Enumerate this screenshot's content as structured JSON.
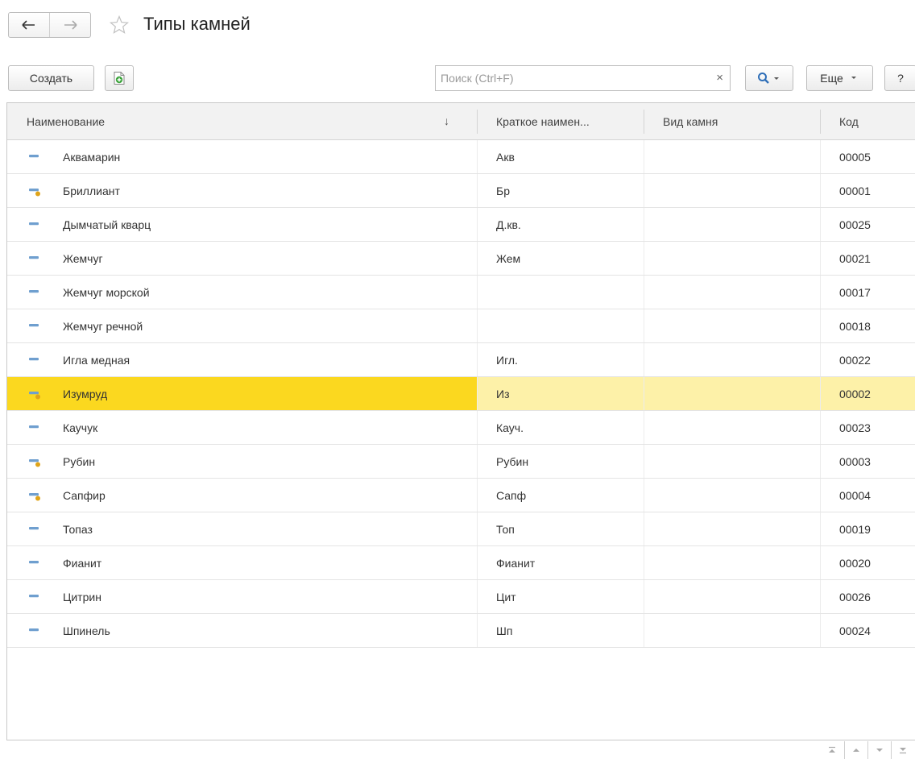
{
  "window": {
    "title": "Типы камней"
  },
  "toolbar": {
    "create_label": "Создать",
    "search_placeholder": "Поиск (Ctrl+F)",
    "clear_glyph": "×",
    "more_label": "Еще",
    "help_label": "?"
  },
  "table": {
    "columns": [
      "Наименование",
      "Краткое наимен...",
      "Вид камня",
      "Код"
    ],
    "sorted_column": "Наименование",
    "sort_direction": "↓",
    "rows": [
      {
        "name": "Аквамарин",
        "short": "Акв",
        "kind": "",
        "code": "00005",
        "icon": "catalog-item-icon",
        "selected": false
      },
      {
        "name": "Бриллиант",
        "short": "Бр",
        "kind": "",
        "code": "00001",
        "icon": "predefined-item-icon",
        "selected": false
      },
      {
        "name": "Дымчатый кварц",
        "short": "Д.кв.",
        "kind": "",
        "code": "00025",
        "icon": "catalog-item-icon",
        "selected": false
      },
      {
        "name": "Жемчуг",
        "short": "Жем",
        "kind": "",
        "code": "00021",
        "icon": "catalog-item-icon",
        "selected": false
      },
      {
        "name": "Жемчуг морской",
        "short": "",
        "kind": "",
        "code": "00017",
        "icon": "catalog-item-icon",
        "selected": false
      },
      {
        "name": "Жемчуг речной",
        "short": "",
        "kind": "",
        "code": "00018",
        "icon": "catalog-item-icon",
        "selected": false
      },
      {
        "name": "Игла медная",
        "short": "Игл.",
        "kind": "",
        "code": "00022",
        "icon": "catalog-item-icon",
        "selected": false
      },
      {
        "name": "Изумруд",
        "short": "Из",
        "kind": "",
        "code": "00002",
        "icon": "predefined-item-icon",
        "selected": true
      },
      {
        "name": "Каучук",
        "short": "Кауч.",
        "kind": "",
        "code": "00023",
        "icon": "catalog-item-icon",
        "selected": false
      },
      {
        "name": "Рубин",
        "short": "Рубин",
        "kind": "",
        "code": "00003",
        "icon": "predefined-item-icon",
        "selected": false
      },
      {
        "name": "Сапфир",
        "short": "Сапф",
        "kind": "",
        "code": "00004",
        "icon": "predefined-item-icon",
        "selected": false
      },
      {
        "name": "Топаз",
        "short": "Топ",
        "kind": "",
        "code": "00019",
        "icon": "catalog-item-icon",
        "selected": false
      },
      {
        "name": "Фианит",
        "short": "Фианит",
        "kind": "",
        "code": "00020",
        "icon": "catalog-item-icon",
        "selected": false
      },
      {
        "name": "Цитрин",
        "short": "Цит",
        "kind": "",
        "code": "00026",
        "icon": "catalog-item-icon",
        "selected": false
      },
      {
        "name": "Шпинель",
        "short": "Шп",
        "kind": "",
        "code": "00024",
        "icon": "catalog-item-icon",
        "selected": false
      }
    ]
  },
  "colors": {
    "selection": "#fbd81f",
    "selection_light": "#fdf1a8",
    "header_bg": "#f2f2f2",
    "item_icon": "#6f9fcf",
    "predefined_dot": "#e0a419",
    "search_accent": "#2f6fb8",
    "add_green": "#3aa33a"
  }
}
